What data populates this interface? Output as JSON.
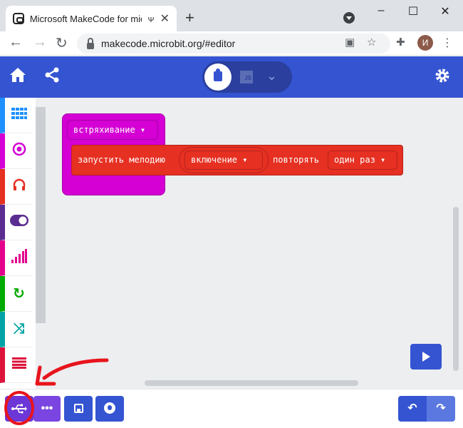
{
  "browser": {
    "tab_title": "Microsoft MakeCode for micro:bit",
    "tab_close": "✕",
    "new_tab": "+",
    "url": "makecode.microbit.org/#editor",
    "window_controls": [
      "–",
      "☐",
      "✕"
    ],
    "avatar_letter": "И"
  },
  "header": {
    "js_label": "JS"
  },
  "toolbox": {
    "categories": [
      {
        "name": "Basic",
        "color": "#1e90ff",
        "icon": "grid-icon"
      },
      {
        "name": "Input",
        "color": "#d400d4",
        "icon": "target-icon"
      },
      {
        "name": "Music",
        "color": "#e63022",
        "icon": "headphones-icon"
      },
      {
        "name": "Led",
        "color": "#5c2d91",
        "icon": "toggle-icon"
      },
      {
        "name": "Radio",
        "color": "#e3008c",
        "icon": "signal-icon"
      },
      {
        "name": "Loops",
        "color": "#00aa00",
        "icon": "loop-icon"
      },
      {
        "name": "Logic",
        "color": "#00a4a6",
        "icon": "shuffle-icon"
      },
      {
        "name": "Variables",
        "color": "#dc143c",
        "icon": "lines-icon"
      }
    ]
  },
  "workspace": {
    "event_label": "встряхивание ▾",
    "play_prefix": "запустить мелодию",
    "melody_value": "включение ▾",
    "repeat_label": "повторять",
    "repeat_value": "один раз ▾"
  },
  "bottom_bar": {
    "more_label": "•••"
  },
  "annotation": {
    "color": "#e8141c"
  }
}
